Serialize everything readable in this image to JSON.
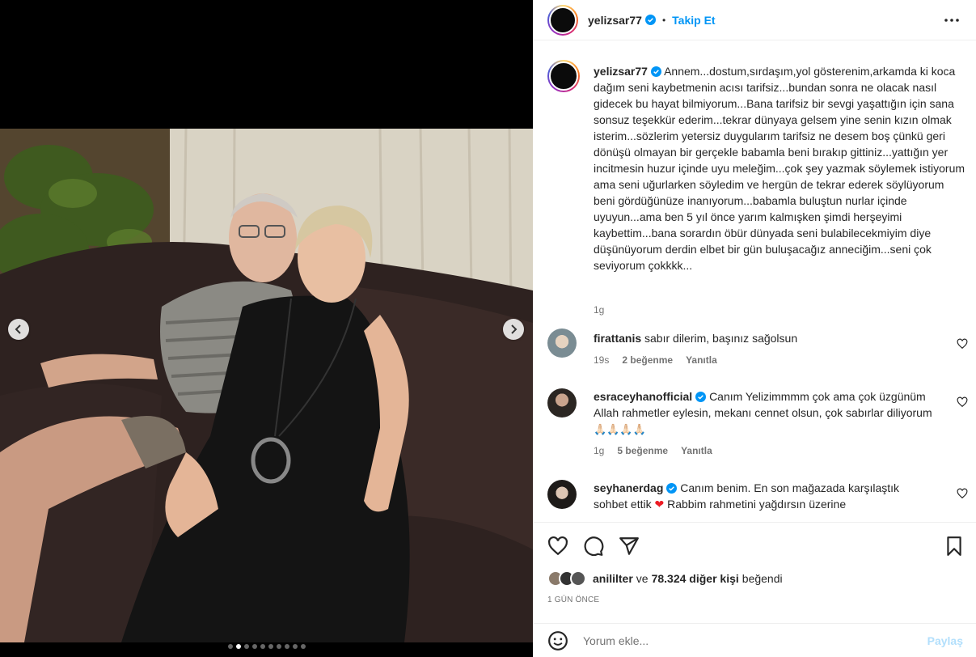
{
  "post": {
    "author": "yelizsar77",
    "follow_label": "Takip Et",
    "separator": "•",
    "caption": "Annem...dostum,sırdaşım,yol gösterenim,arkamda ki koca dağım seni kaybetmenin acısı tarifsiz...bundan sonra ne olacak nasıl gidecek bu hayat bilmiyorum...Bana tarifsiz bir sevgi yaşattığın için sana sonsuz teşekkür ederim...tekrar dünyaya gelsem yine senin kızın olmak isterim...sözlerim yetersiz duygularım tarifsiz ne desem boş çünkü geri dönüşü olmayan bir gerçekle babamla beni bırakıp gittiniz...yattığın yer incitmesin huzur içinde uyu meleğim...çok şey yazmak söylemek istiyorum ama seni uğurlarken söyledim ve hergün de tekrar ederek söylüyorum beni gördüğünüze inanıyorum...babamla buluştun nurlar içinde uyuyun...ama ben 5 yıl önce yarım kalmışken şimdi herşeyimi kaybettim...bana sorardın öbür dünyada seni bulabilecekmiyim diye düşünüyorum derdin elbet bir gün buluşacağız anneciğim...seni çok seviyorum çokkkk...",
    "caption_time": "1g"
  },
  "comments": [
    {
      "user": "firattanis",
      "verified": false,
      "text": "sabır dilerim, başınız sağolsun",
      "time": "19s",
      "likes": "2 beğenme",
      "reply": "Yanıtla"
    },
    {
      "user": "esraceyhanofficial",
      "verified": true,
      "text": "Canım Yelizimmmm çok ama çok üzgünüm Allah rahmetler eylesin, mekanı cennet olsun, çok sabırlar diliyorum",
      "emoji": "🙏🏻🙏🏻🙏🏻🙏🏻",
      "time": "1g",
      "likes": "5 beğenme",
      "reply": "Yanıtla"
    },
    {
      "user": "seyhanerdag",
      "verified": true,
      "text_a": "Canım benim. En son mağazada karşılaştık sohbet ettik",
      "heart": "❤",
      "text_b": "Rabbim rahmetini yağdırsın üzerine"
    }
  ],
  "likes_line": {
    "user": "anililter",
    "connector": "ve",
    "others": "78.324 diğer kişi",
    "suffix": "beğendi"
  },
  "date": "1 GÜN ÖNCE",
  "add_comment": {
    "placeholder": "Yorum ekle...",
    "post_label": "Paylaş"
  },
  "carousel": {
    "slide_count": 10,
    "active_index": 1
  },
  "icons": {
    "more": "more-horizontal-icon",
    "like": "heart-icon",
    "comment": "comment-icon",
    "share": "share-icon",
    "save": "bookmark-icon",
    "emoji": "emoji-icon",
    "prev": "chevron-left-icon",
    "next": "chevron-right-icon"
  },
  "colors": {
    "accent": "#0095f6",
    "muted": "#737373",
    "verified": "#0095f6",
    "post_disabled": "#b2dffc"
  }
}
